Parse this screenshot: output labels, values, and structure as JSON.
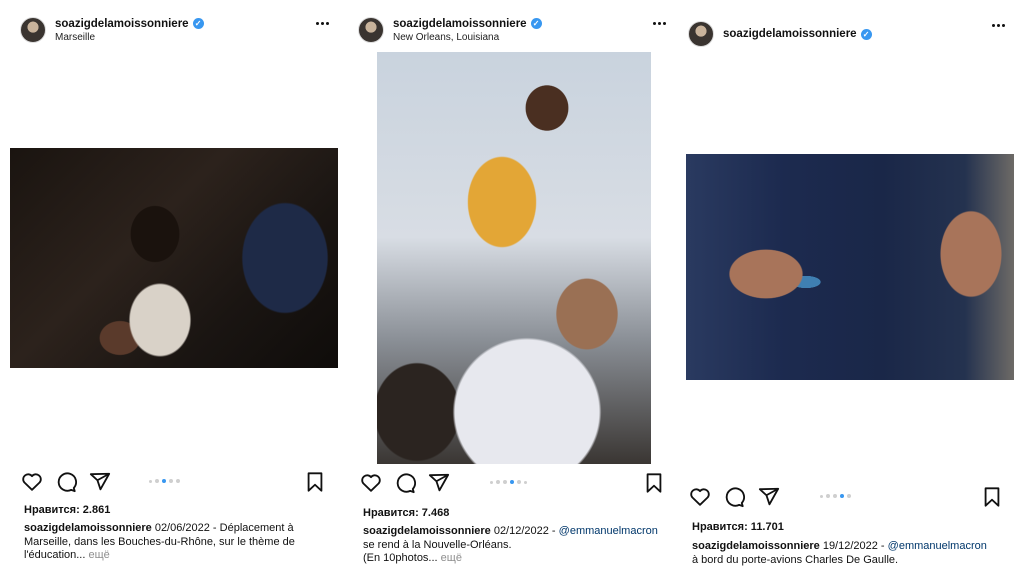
{
  "posts": [
    {
      "username": "soazigdelamoissonniere",
      "location": "Marseille",
      "likes": "Нравится: 2.861",
      "caption_user": "soazigdelamoissonniere",
      "caption_line1": " 02/06/2022 - Déplacement à",
      "caption_line2": "Marseille, dans les Bouches-du-Rhône, sur le thème de",
      "caption_line3": "l'éducation...",
      "more": " ещё",
      "carousel": {
        "count": 5,
        "active": 2
      }
    },
    {
      "username": "soazigdelamoissonniere",
      "location": "New Orleans, Louisiana",
      "likes": "Нравится: 7.468",
      "caption_user": "soazigdelamoissonniere",
      "caption_date": " 02/12/2022 - ",
      "mention": "@emmanuelmacron",
      "caption_line2": "se rend à la Nouvelle-Orléans.",
      "caption_line3": "(En 10photos...",
      "more": " ещё",
      "carousel": {
        "count": 6,
        "active": 3
      }
    },
    {
      "username": "soazigdelamoissonniere",
      "location": "",
      "likes": "Нравится: 11.701",
      "caption_user": "soazigdelamoissonniere",
      "caption_date": " 19/12/2022 - ",
      "mention": "@emmanuelmacron",
      "caption_line2": "à bord du porte-avions Charles De Gaulle.",
      "carousel": {
        "count": 5,
        "active": 3
      }
    }
  ],
  "icons": {
    "like": "heart-icon",
    "comment": "comment-icon",
    "share": "paper-plane-icon",
    "bookmark": "bookmark-icon",
    "verified": "verified-badge-icon",
    "more": "more-horizontal-icon"
  },
  "colors": {
    "verified": "#3897f0",
    "carousel_active": "#3897f0",
    "mention": "#00376b",
    "muted": "#8e8e8e"
  }
}
